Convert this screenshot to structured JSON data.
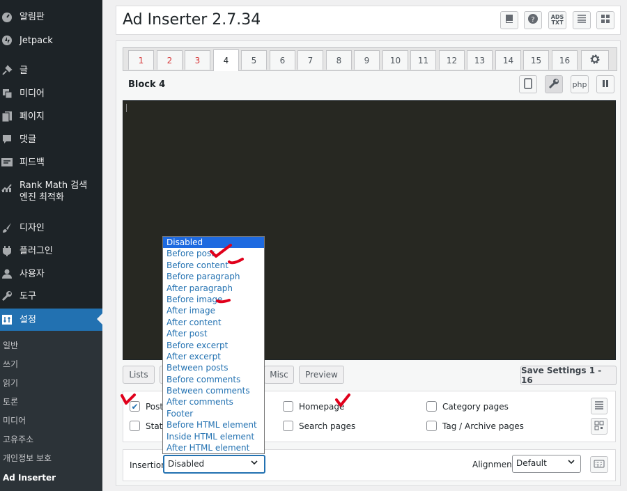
{
  "sidebar": {
    "items": [
      {
        "label": "알림판",
        "icon": "dashboard-icon"
      },
      {
        "label": "Jetpack",
        "icon": "jetpack-icon"
      },
      {
        "label": "글",
        "icon": "pin-icon"
      },
      {
        "label": "미디어",
        "icon": "media-icon"
      },
      {
        "label": "페이지",
        "icon": "page-icon"
      },
      {
        "label": "댓글",
        "icon": "comment-icon"
      },
      {
        "label": "피드백",
        "icon": "feedback-icon"
      },
      {
        "label": "Rank Math 검색\n엔진 최적화",
        "icon": "rank-math-icon"
      },
      {
        "label": "디자인",
        "icon": "brush-icon"
      },
      {
        "label": "플러그인",
        "icon": "plugin-icon"
      },
      {
        "label": "사용자",
        "icon": "user-icon"
      },
      {
        "label": "도구",
        "icon": "wrench-icon"
      },
      {
        "label": "설정",
        "icon": "settings-icon"
      }
    ],
    "submenu": [
      "일반",
      "쓰기",
      "읽기",
      "토론",
      "미디어",
      "고유주소",
      "개인정보 보호",
      "Ad Inserter"
    ]
  },
  "header": {
    "title": "Ad Inserter 2.7.34",
    "ads_txt_label": "ADS\nTXT"
  },
  "tabs": [
    "1",
    "2",
    "3",
    "4",
    "5",
    "6",
    "7",
    "8",
    "9",
    "10",
    "11",
    "12",
    "13",
    "14",
    "15",
    "16"
  ],
  "block": {
    "title": "Block 4",
    "php_label": "php"
  },
  "buttons": {
    "lists": "Lists",
    "misc": "Misc",
    "preview": "Preview",
    "save": "Save Settings 1 - 16"
  },
  "options": {
    "posts": "Posts",
    "static": "Static",
    "homepage": "Homepage",
    "search_pages": "Search pages",
    "category_pages": "Category pages",
    "tag_archive_pages": "Tag / Archive pages"
  },
  "insertion": {
    "label": "Insertion",
    "value": "Disabled",
    "options": [
      "Disabled",
      "Before post",
      "Before content",
      "Before paragraph",
      "After paragraph",
      "Before image",
      "After image",
      "After content",
      "After post",
      "Before excerpt",
      "After excerpt",
      "Between posts",
      "Before comments",
      "Between comments",
      "After comments",
      "Footer",
      "Before HTML element",
      "Inside HTML element",
      "After HTML element"
    ]
  },
  "alignment": {
    "label": "Alignment",
    "value": "Default"
  },
  "colors": {
    "sidebar_bg": "#1d2327",
    "active_blue": "#2271b1",
    "selected_option": "#1e6ae0",
    "annotation_red": "#e0001b"
  }
}
